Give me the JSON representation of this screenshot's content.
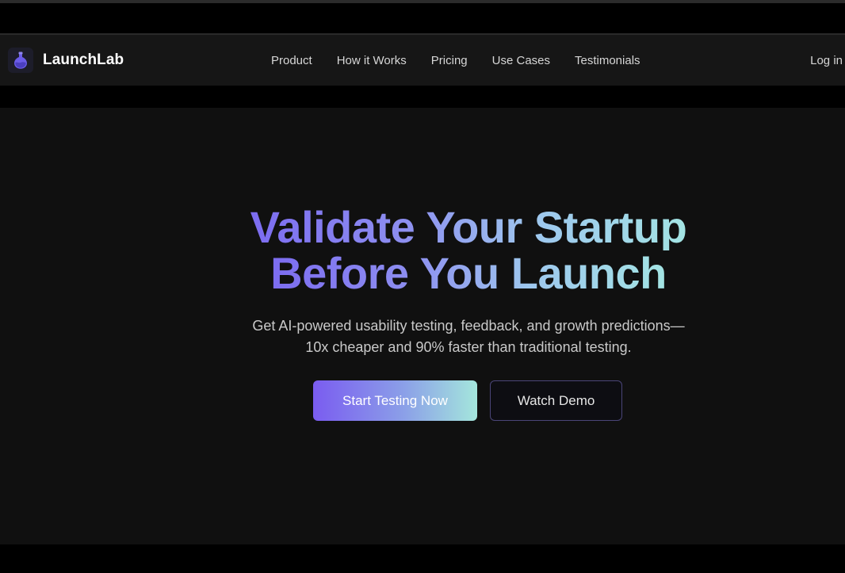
{
  "brand": {
    "name": "LaunchLab",
    "logo_icon": "flask-icon",
    "logo_color": "#6b5ce7"
  },
  "nav": {
    "links": [
      "Product",
      "How it Works",
      "Pricing",
      "Use Cases",
      "Testimonials"
    ],
    "login_label": "Log in"
  },
  "hero": {
    "headline_line1": "Validate Your Startup",
    "headline_line2": "Before You Launch",
    "subtitle_line1": "Get AI-powered usability testing, feedback, and growth predictions—",
    "subtitle_line2": "10x cheaper and 90% faster than traditional testing.",
    "primary_cta": "Start Testing Now",
    "secondary_cta": "Watch Demo"
  },
  "colors": {
    "accent_purple": "#7a5cf0",
    "accent_teal": "#a4e6dc",
    "background": "#101010",
    "navbar": "#161616"
  }
}
